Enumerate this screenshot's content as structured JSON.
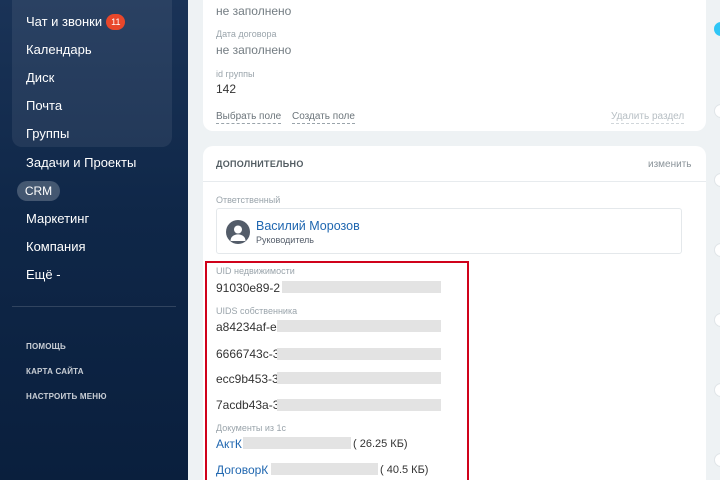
{
  "sidebar": {
    "items": [
      {
        "label": "Чат и звонки",
        "badge": "11"
      },
      {
        "label": "Календарь"
      },
      {
        "label": "Диск"
      },
      {
        "label": "Почта"
      },
      {
        "label": "Группы"
      },
      {
        "label": "Задачи и Проекты"
      },
      {
        "label": "CRM"
      },
      {
        "label": "Маркетинг"
      },
      {
        "label": "Компания"
      },
      {
        "label": "Ещё -"
      }
    ],
    "links": [
      "ПОМОЩЬ",
      "КАРТА САЙТА",
      "НАСТРОИТЬ МЕНЮ"
    ]
  },
  "top_card": {
    "field1_value": "не заполнено",
    "field2_label": "Дата договора",
    "field2_value": "не заполнено",
    "field3_label": "id группы",
    "field3_value": "142",
    "select_field": "Выбрать поле",
    "create_field": "Создать поле",
    "delete_section": "Удалить раздел"
  },
  "extra_section": {
    "title": "ДОПОЛНИТЕЛЬНО",
    "change": "изменить",
    "responsible_label": "Ответственный",
    "responsible_name": "Василий Морозов",
    "responsible_role": "Руководитель",
    "uid_label": "UID недвижимости",
    "uid_value": "91030e89-2",
    "uids_owner_label": "UIDS собственника",
    "uids_owner_values": [
      "a84234af-e7",
      "6666743c-3",
      "ecc9b453-3",
      "7acdb43a-3"
    ],
    "docs_label": "Документы из 1с",
    "docs": [
      {
        "name": "АктК",
        "size": "( 26.25 КБ)"
      },
      {
        "name": "ДоговорК",
        "size": "( 40.5 КБ)"
      }
    ]
  },
  "colors": {
    "accent_link": "#2067b0",
    "highlight": "#d0021b",
    "badge": "#e8472b"
  }
}
